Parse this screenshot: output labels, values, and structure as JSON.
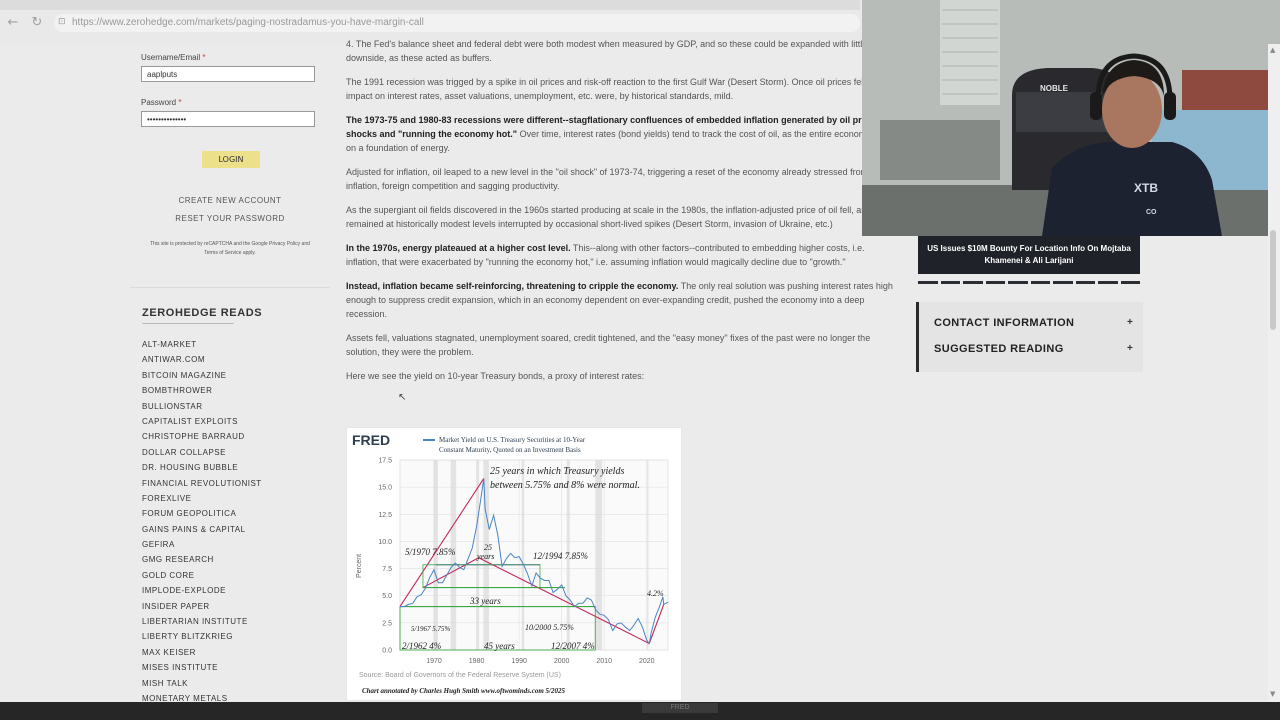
{
  "browser": {
    "url": "https://www.zerohedge.com/markets/paging-nostradamus-you-have-margin-call"
  },
  "login": {
    "username_label": "Username/Email",
    "username_value": "aaplputs",
    "password_label": "Password",
    "password_mask": "••••••••••••••",
    "required_mark": "*",
    "login_button": "LOGIN",
    "create_account": "CREATE NEW ACCOUNT",
    "reset_password": "RESET YOUR PASSWORD",
    "captcha_note": "This site is protected by reCAPTCHA and the Google Privacy Policy and Terms of Service apply."
  },
  "reads": {
    "title": "ZEROHEDGE READS",
    "items": [
      "ALT-MARKET",
      "ANTIWAR.COM",
      "BITCOIN MAGAZINE",
      "BOMBTHROWER",
      "BULLIONSTAR",
      "CAPITALIST EXPLOITS",
      "CHRISTOPHE BARRAUD",
      "DOLLAR COLLAPSE",
      "DR. HOUSING BUBBLE",
      "FINANCIAL REVOLUTIONIST",
      "FOREXLIVE",
      "FORUM GEOPOLITICA",
      "GAINS PAINS & CAPITAL",
      "GEFIRA",
      "GMG RESEARCH",
      "GOLD CORE",
      "IMPLODE-EXPLODE",
      "INSIDER PAPER",
      "LIBERTARIAN INSTITUTE",
      "LIBERTY BLITZKRIEG",
      "MAX KEISER",
      "MISES INSTITUTE",
      "MISH TALK",
      "MONETARY METALS"
    ]
  },
  "article": {
    "p1": "4. The Fed's balance sheet and federal debt were both modest when measured by GDP, and so these could be expanded with little downside, as these acted as buffers.",
    "p2": "The 1991 recession was trigged by a spike in oil prices and risk-off reaction to the first Gulf War (Desert Storm). Once oil prices fell, the impact on interest rates, asset valuations, unemployment, etc. were, by historical standards, mild.",
    "p3_bold": "The 1973-75 and 1980-83 recessions were different--stagflationary confluences of embedded inflation generated by oil price shocks and \"running the economy hot.\"",
    "p3_rest": " Over time, interest rates (bond yields) tend to track the cost of oil, as the entire economy rests on a foundation of energy.",
    "p4": "Adjusted for inflation, oil leaped to a new level in the \"oil shock\" of 1973-74, triggering a reset of the economy already stressed from higher inflation, foreign competition and sagging productivity.",
    "p5": "As the supergiant oil fields discovered in the 1960s started producing at scale in the 1980s, the inflation-adjusted price of oil fell, and remained at historically modest levels interrupted by occasional short-lived spikes (Desert Storm, invasion of Ukraine, etc.)",
    "p6_bold": "In the 1970s, energy plateaued at a higher cost level.",
    "p6_rest": " This--along with other factors--contributed to embedding higher costs, i.e. inflation, that were exacerbated by \"running the economy hot,\" i.e. assuming inflation would magically decline due to \"growth.\"",
    "p7_bold": "Instead, inflation became self-reinforcing, threatening to cripple the economy.",
    "p7_rest": " The only real solution was pushing interest rates high enough to suppress credit expansion, which in an economy dependent on ever-expanding credit, pushed the economy into a deep recession.",
    "p8": "Assets fell, valuations stagnated, unemployment soared, credit tightened, and the \"easy money\" fixes of the past were no longer the solution, they were the problem.",
    "p9": "Here we see the yield on 10-year Treasury bonds, a proxy of interest rates:"
  },
  "chart_data": {
    "type": "line",
    "brand": "FRED",
    "title": "Market Yield on U.S. Treasury Securities at 10-Year Constant Maturity, Quoted on an Investment Basis",
    "ylabel": "Percent",
    "ylim": [
      0,
      17.5
    ],
    "yticks": [
      "0.0",
      "2.5",
      "5.0",
      "7.5",
      "10.0",
      "12.5",
      "15.0",
      "17.5"
    ],
    "xlim": [
      1962,
      2025
    ],
    "xticks": [
      "1970",
      "1980",
      "1990",
      "2000",
      "2010",
      "2020"
    ],
    "source": "Source: Board of Governors of the Federal Reserve System (US)",
    "credit": "Chart annotated by Charles Hugh Smith  www.oftwominds.com  5/2025",
    "annotations": {
      "a1": "25 years in which Treasury yields between 5.75% and 8% were normal.",
      "a2": "5/1970 7.85%",
      "a3a": "25",
      "a3b": "years",
      "a4": "12/1994  7.85%",
      "a5": "33 years",
      "a6": "5/1967 5.75%",
      "a7": "10/2000  5.75%",
      "a8": "2/1962  4%",
      "a9": "45 years",
      "a10": "12/2007  4%",
      "a11": "4.2%"
    },
    "series": [
      {
        "x": [
          1962,
          1963,
          1964,
          1965,
          1966,
          1967,
          1968,
          1969,
          1970,
          1971,
          1972,
          1973,
          1974,
          1975,
          1976,
          1977,
          1978,
          1979,
          1980,
          1981,
          1981.7,
          1982,
          1983,
          1984,
          1985,
          1986,
          1987,
          1988,
          1989,
          1990,
          1991,
          1992,
          1993,
          1994,
          1995,
          1996,
          1997,
          1998,
          1999,
          2000,
          2001,
          2002,
          2003,
          2004,
          2005,
          2006,
          2007,
          2008,
          2009,
          2010,
          2011,
          2012,
          2013,
          2014,
          2015,
          2016,
          2017,
          2018,
          2019,
          2020,
          2020.6,
          2021,
          2022,
          2023,
          2023.8,
          2024,
          2025
        ],
        "values": [
          4.0,
          4.0,
          4.2,
          4.3,
          4.9,
          5.1,
          5.7,
          6.7,
          7.4,
          6.2,
          6.2,
          6.9,
          7.6,
          8.0,
          7.6,
          7.4,
          8.4,
          9.4,
          11.4,
          13.9,
          15.8,
          13.0,
          11.1,
          12.4,
          10.6,
          7.7,
          8.4,
          8.9,
          8.5,
          8.6,
          7.9,
          7.0,
          5.9,
          7.1,
          6.6,
          6.4,
          6.4,
          5.3,
          5.6,
          6.0,
          5.0,
          4.6,
          4.0,
          4.3,
          4.3,
          4.8,
          4.6,
          3.7,
          3.3,
          3.2,
          2.8,
          1.8,
          2.4,
          2.5,
          2.1,
          1.8,
          2.3,
          2.9,
          2.1,
          0.9,
          0.6,
          1.5,
          3.0,
          4.0,
          4.9,
          4.2,
          4.4
        ]
      }
    ]
  },
  "sidebar": {
    "news_title": "US Issues $10M Bounty For Location Info On Mojtaba Khamenei & Ali Larijani",
    "contact": "CONTACT INFORMATION",
    "suggested": "SUGGESTED READING",
    "plus": "+"
  },
  "webcam": {
    "chair_logo": "NOBLE",
    "hoodie_text": "XTB",
    "hoodie_small": "CO"
  },
  "taskbar": {
    "item": "FRED"
  }
}
